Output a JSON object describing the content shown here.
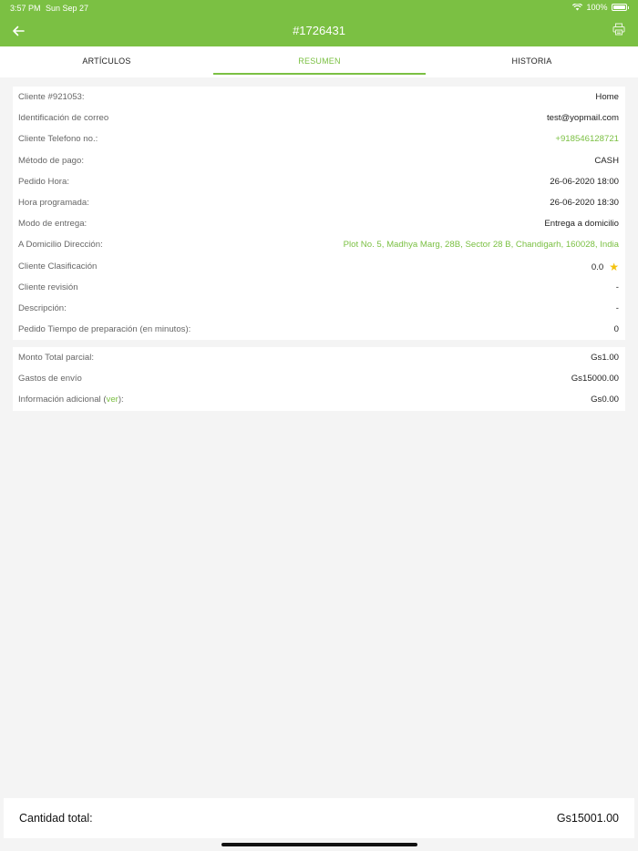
{
  "status": {
    "time": "3:57 PM",
    "date": "Sun Sep 27",
    "battery": "100%"
  },
  "header": {
    "title": "#1726431",
    "back_icon": "arrow-left-icon",
    "print_icon": "printer-icon",
    "accent": "#7bc043"
  },
  "tabs": [
    {
      "label": "ARTÍCULOS",
      "active": false
    },
    {
      "label": "RESUMEN",
      "active": true
    },
    {
      "label": "HISTORIA",
      "active": false
    }
  ],
  "summary": {
    "rows": [
      {
        "label": "Cliente #921053:",
        "value": "Home"
      },
      {
        "label": "Identificación de correo",
        "value": "test@yopmail.com"
      },
      {
        "label": "Cliente Telefono no.:",
        "value": "+918546128721"
      },
      {
        "label": "Método de pago:",
        "value": "CASH"
      },
      {
        "label": "Pedido Hora:",
        "value": "26-06-2020 18:00"
      },
      {
        "label": "Hora programada:",
        "value": "26-06-2020 18:30"
      },
      {
        "label": "Modo de entrega:",
        "value": "Entrega a domicilio"
      },
      {
        "label": "A Domicilio Dirección:",
        "value": "Plot No. 5, Madhya Marg, 28B, Sector 28 B, Chandigarh, 160028, India"
      },
      {
        "label": "Cliente Clasificación",
        "value": "0.0"
      },
      {
        "label": "Cliente revisión",
        "value": "-"
      },
      {
        "label": "Descripción:",
        "value": "-"
      },
      {
        "label": "Pedido Tiempo de preparación (en minutos):",
        "value": "0"
      }
    ]
  },
  "amounts": {
    "subtotal_label": "Monto Total parcial:",
    "subtotal_value": "Gs1.00",
    "shipping_label": "Gastos de envío",
    "shipping_value": "Gs15000.00",
    "additional_label_pre": "Información adicional (",
    "additional_link": "ver",
    "additional_label_post": "):",
    "additional_value": "Gs0.00"
  },
  "footer": {
    "total_label": "Cantidad total:",
    "total_value": "Gs15001.00"
  }
}
